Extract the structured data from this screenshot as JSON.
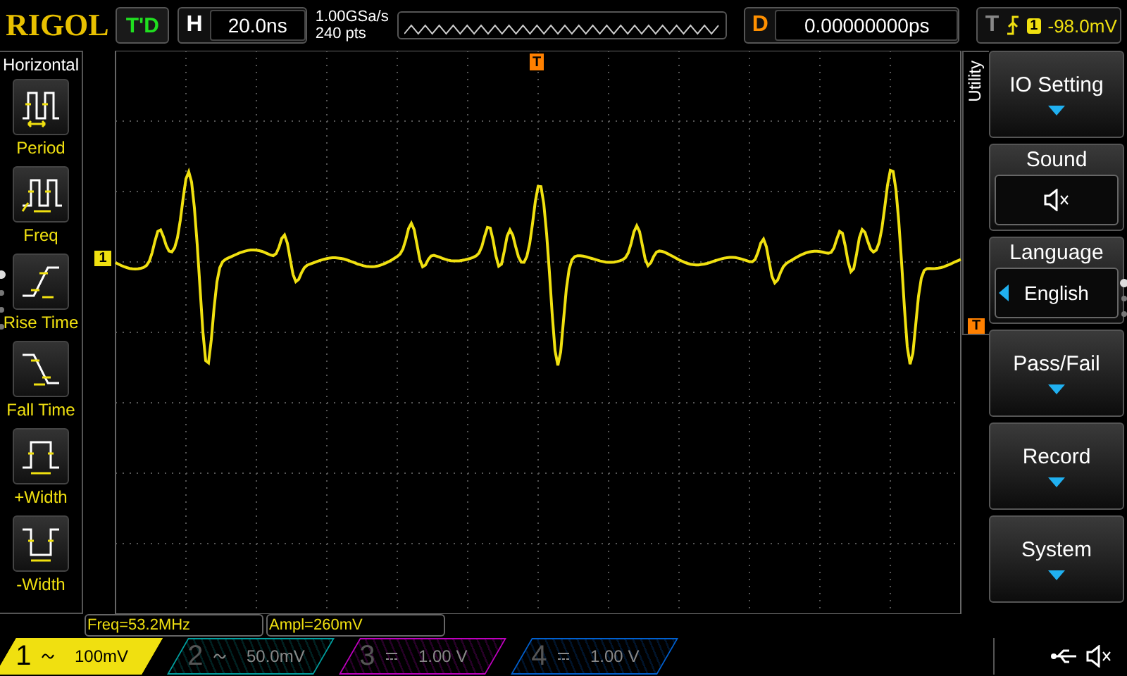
{
  "header": {
    "logo": "RIGOL",
    "run_status": "T'D",
    "timebase": {
      "label": "H",
      "value": "20.0ns"
    },
    "sample_rate": "1.00GSa/s",
    "memory_depth": "240 pts",
    "delay": {
      "label": "D",
      "value": "0.00000000ps"
    },
    "trigger": {
      "label": "T",
      "source": "1",
      "level": "-98.0mV"
    }
  },
  "left_menu": {
    "title": "Horizontal",
    "items": [
      {
        "kind": "period",
        "label": "Period"
      },
      {
        "kind": "freq",
        "label": "Freq"
      },
      {
        "kind": "rise",
        "label": "Rise Time"
      },
      {
        "kind": "fall",
        "label": "Fall Time"
      },
      {
        "kind": "pwidth",
        "label": "+Width"
      },
      {
        "kind": "nwidth",
        "label": "-Width"
      }
    ]
  },
  "display": {
    "channel_marker": "1",
    "trigger_position_marker": "T",
    "trigger_level_marker": "T"
  },
  "measurements": [
    "Freq=53.2MHz",
    "Ampl=260mV"
  ],
  "right_menu": {
    "title": "Utility",
    "items": [
      {
        "kind": "submenu",
        "label": "IO Setting"
      },
      {
        "kind": "icon",
        "label": "Sound"
      },
      {
        "kind": "value",
        "label": "Language",
        "value": "English"
      },
      {
        "kind": "submenu",
        "label": "Pass/Fail"
      },
      {
        "kind": "submenu",
        "label": "Record"
      },
      {
        "kind": "submenu",
        "label": "System"
      }
    ]
  },
  "channels": [
    {
      "number": "1",
      "kind": "ac",
      "scale": "100mV",
      "selected": true,
      "color": "#f0e010"
    },
    {
      "number": "2",
      "kind": "ac",
      "scale": "50.0mV",
      "selected": false,
      "color": "#00a0a0"
    },
    {
      "number": "3",
      "kind": "dc",
      "scale": "1.00 V",
      "selected": false,
      "color": "#c000c0"
    },
    {
      "number": "4",
      "kind": "dc",
      "scale": "1.00 V",
      "selected": false,
      "color": "#0060d0"
    }
  ]
}
